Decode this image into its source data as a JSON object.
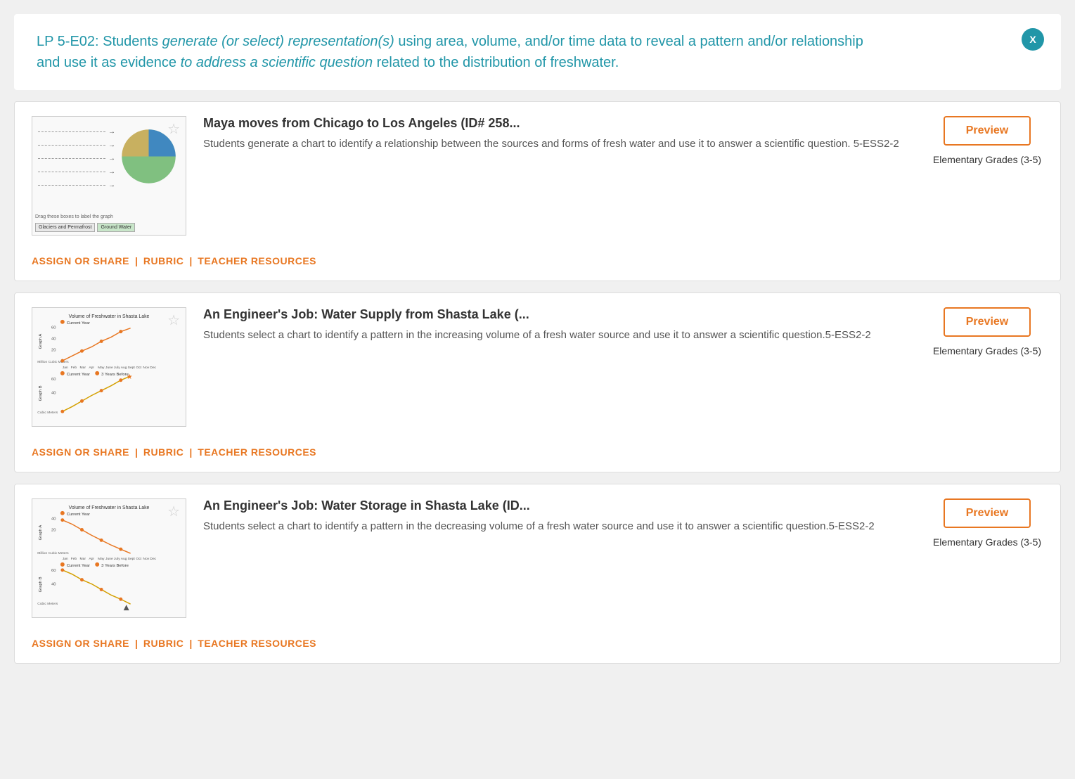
{
  "header": {
    "text_prefix": "LP 5-E02: Students ",
    "text_italic1": "generate (or select) representation(s)",
    "text_middle": " using area, volume, and/or time data to reveal a pattern and/or relationship and use it as evidence ",
    "text_italic2": "to address a scientific question",
    "text_suffix": " related to the distribution of freshwater.",
    "close_label": "X"
  },
  "cards": [
    {
      "id": "card1",
      "title": "Maya moves from Chicago to Los Angeles (ID# 258...",
      "description": "Students generate a chart to identify a relationship between the sources and forms of fresh water and use it to answer a scientific question. 5-ESS2-2",
      "preview_label": "Preview",
      "grade_label": "Elementary Grades (3-5)",
      "footer": {
        "assign": "ASSIGN OR SHARE",
        "rubric": "RUBRIC",
        "teacher": "TEACHER RESOURCES"
      },
      "thumbnail_type": "pie"
    },
    {
      "id": "card2",
      "title": "An Engineer's Job: Water Supply from Shasta Lake (...",
      "description": "Students select a chart to identify a pattern in the increasing volume of a fresh water source and use it to answer a scientific question.5-ESS2-2",
      "preview_label": "Preview",
      "grade_label": "Elementary Grades (3-5)",
      "footer": {
        "assign": "ASSIGN OR SHARE",
        "rubric": "RUBRIC",
        "teacher": "TEACHER RESOURCES"
      },
      "thumbnail_type": "line_up"
    },
    {
      "id": "card3",
      "title": "An Engineer's Job: Water Storage in Shasta Lake (ID...",
      "description": "Students select a chart to identify a pattern in the decreasing volume of a fresh water source and use it to answer a scientific question.5-ESS2-2",
      "preview_label": "Preview",
      "grade_label": "Elementary Grades (3-5)",
      "footer": {
        "assign": "ASSIGN OR SHARE",
        "rubric": "RUBRIC",
        "teacher": "TEACHER RESOURCES"
      },
      "thumbnail_type": "line_down"
    }
  ],
  "chart_labels": {
    "title": "Volume of Freshwater in Shasta Lake",
    "legend_current": "Current Year",
    "legend_past": "3 Years Before",
    "months": "Jan Feb Mar Apr May June July Aug Sept Oct Nov Dec",
    "graph_a": "Graph A",
    "graph_b": "Graph B",
    "drag_text": "Drag these boxes to label the graph",
    "label_glaciers": "Glaciers and Permafrost",
    "label_ground": "Ground Water"
  },
  "colors": {
    "teal": "#2196a8",
    "orange": "#e87722",
    "star_empty": "#ccc",
    "pie_green": "#80c080",
    "pie_tan": "#c8b060",
    "pie_blue": "#4088c0"
  }
}
